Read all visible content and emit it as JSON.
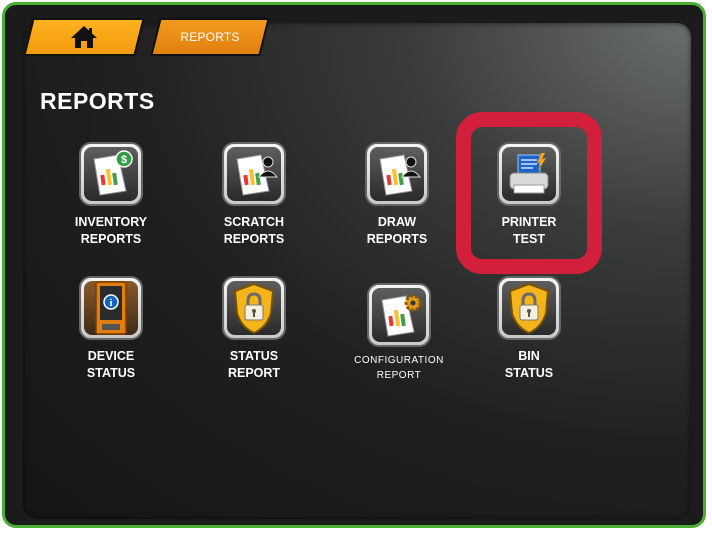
{
  "breadcrumb": {
    "home_icon": "home-icon",
    "current": "REPORTS"
  },
  "page": {
    "title": "REPORTS"
  },
  "items": [
    {
      "line1": "INVENTORY",
      "line2": "REPORTS",
      "icon": "report-dollar-icon"
    },
    {
      "line1": "SCRATCH",
      "line2": "REPORTS",
      "icon": "report-user-icon"
    },
    {
      "line1": "DRAW",
      "line2": "REPORTS",
      "icon": "report-user-icon"
    },
    {
      "line1": "PRINTER",
      "line2": "TEST",
      "icon": "printer-icon"
    },
    {
      "line1": "DEVICE",
      "line2": "STATUS",
      "icon": "vending-machine-icon"
    },
    {
      "line1": "STATUS",
      "line2": "REPORT",
      "icon": "lock-shield-icon"
    },
    {
      "line1": "CONFIGURATION",
      "line2": "REPORT",
      "icon": "report-gear-icon"
    },
    {
      "line1": "BIN",
      "line2": "STATUS",
      "icon": "lock-shield-icon"
    }
  ],
  "colors": {
    "frame_border": "#4caf35",
    "tab_orange": "#f29a0c",
    "highlight_red": "#d21f3c"
  }
}
